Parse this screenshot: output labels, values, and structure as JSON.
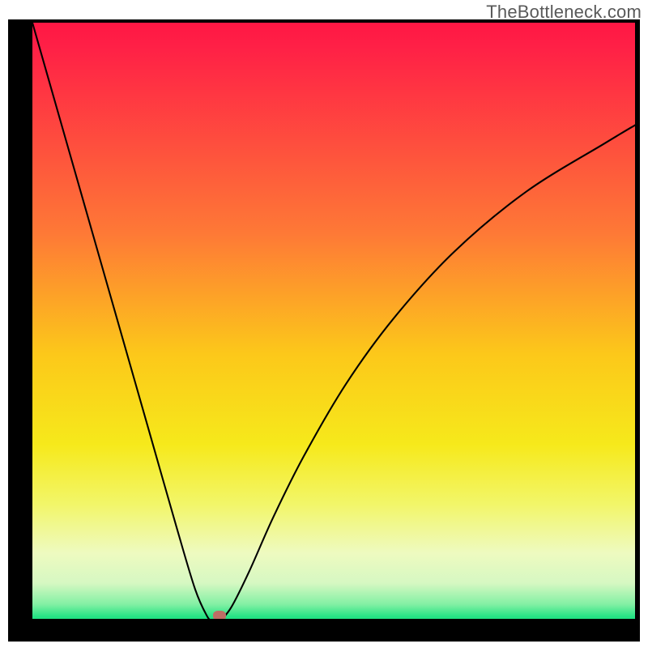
{
  "watermark": {
    "text": "TheBottleneck.com"
  },
  "chart_data": {
    "type": "line",
    "title": "",
    "xlabel": "",
    "ylabel": "",
    "xlim": [
      0,
      100
    ],
    "ylim": [
      0,
      100
    ],
    "gradient_stops": [
      {
        "offset": 0,
        "color": "#ff1744"
      },
      {
        "offset": 0.04,
        "color": "#ff2046"
      },
      {
        "offset": 0.35,
        "color": "#fe7936"
      },
      {
        "offset": 0.55,
        "color": "#fcc81a"
      },
      {
        "offset": 0.7,
        "color": "#f6e91b"
      },
      {
        "offset": 0.8,
        "color": "#f2f66a"
      },
      {
        "offset": 0.88,
        "color": "#eefac0"
      },
      {
        "offset": 0.93,
        "color": "#d6f8c2"
      },
      {
        "offset": 0.965,
        "color": "#83f0a4"
      },
      {
        "offset": 0.985,
        "color": "#28e385"
      },
      {
        "offset": 1.0,
        "color": "#0adc79"
      }
    ],
    "series": [
      {
        "name": "bottleneck-curve",
        "x": [
          0,
          4,
          8,
          12,
          16,
          20,
          24,
          27,
          29,
          30,
          30.5,
          31,
          33,
          36,
          40,
          45,
          52,
          60,
          70,
          82,
          95,
          100
        ],
        "y": [
          100,
          86,
          72,
          58,
          44,
          30,
          16,
          6,
          1.5,
          0.6,
          0.4,
          0.6,
          3,
          9,
          18,
          28,
          40,
          51,
          62,
          72,
          80,
          83
        ]
      }
    ],
    "marker": {
      "x": 31,
      "y": 0.6,
      "color": "#bd6e65"
    }
  }
}
